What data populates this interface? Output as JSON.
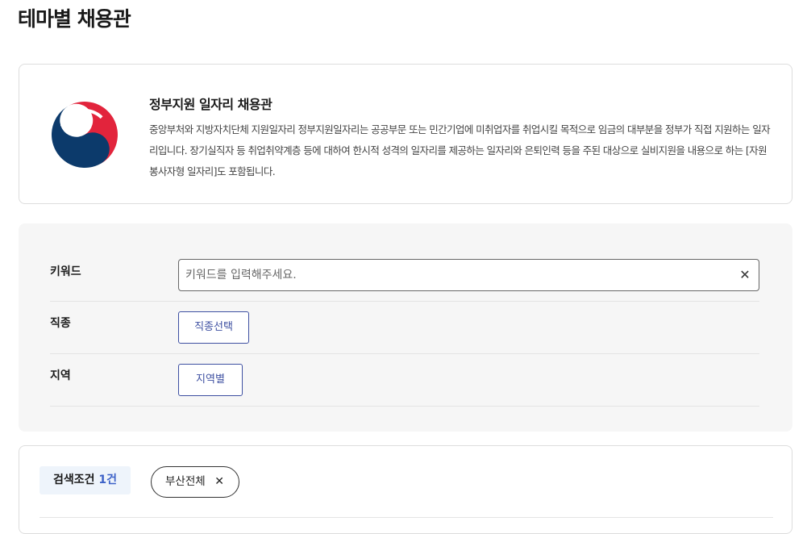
{
  "page": {
    "title": "테마별 채용관"
  },
  "intro": {
    "title": "정부지원 일자리 채용관",
    "description": "중앙부처와 지방자치단체 지원일자리 정부지원일자리는 공공부문 또는 민간기업에 미취업자를 취업시킬 목적으로 임금의 대부분을 정부가 직접 지원하는 일자리입니다. 장기실직자 등 취업취약계층 등에 대하여 한시적 성격의 일자리를 제공하는 일자리와 은퇴인력 등을 주된 대상으로 실비지원을 내용으로 하는 [자원봉사자형 일자리]도 포함됩니다.",
    "emblem_icon": "korea-government-emblem",
    "colors": {
      "blue": "#0c3a6b",
      "red": "#e2243c"
    }
  },
  "filters": {
    "keyword": {
      "label": "키워드",
      "value": "",
      "placeholder": "키워드를 입력해주세요.",
      "clear_glyph": "✕"
    },
    "job": {
      "label": "직종",
      "button": "직종선택"
    },
    "region": {
      "label": "지역",
      "button": "지역별"
    }
  },
  "conditions": {
    "label": "검색조건",
    "count": "1건",
    "chips": [
      {
        "label": "부산전체",
        "remove_glyph": "✕"
      }
    ]
  },
  "colors": {
    "accent": "#3d4fa1",
    "count": "#3d62c8",
    "panel": "#f6f6f6",
    "badge": "#eef4fb"
  }
}
